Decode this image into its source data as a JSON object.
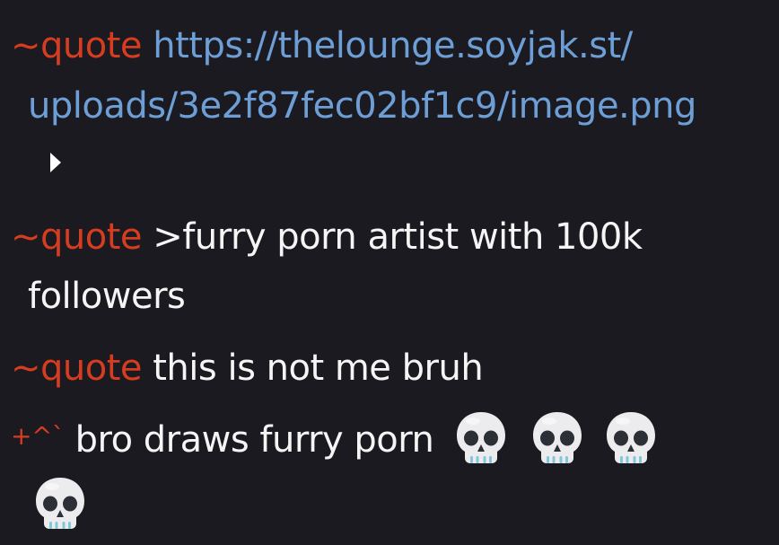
{
  "messages": [
    {
      "nick": "~quote",
      "lines": [
        "https://thelounge.soyjak.st/",
        "uploads/3e2f87fec02bf1c9/image.png"
      ],
      "kind": "link"
    },
    {
      "nick": "~quote",
      "lines": [
        ">furry porn artist with 100k",
        "followers"
      ],
      "kind": "text"
    },
    {
      "nick": "~quote",
      "lines": [
        "this is not me bruh"
      ],
      "kind": "text"
    },
    {
      "nick": "+^`",
      "lines": [
        "bro draws furry porn"
      ],
      "kind": "text",
      "emoji": [
        "skull-icon",
        "skull-icon",
        "skull-icon",
        "skull-icon"
      ]
    }
  ],
  "preview_toggle": "play-triangle-icon",
  "colors": {
    "background": "#1b1a20",
    "nick": "#d63c1f",
    "link": "#6d9fd6",
    "text": "#f5f5f5"
  }
}
